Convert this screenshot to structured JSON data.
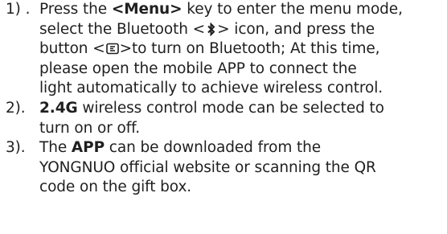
{
  "items": [
    {
      "number": "1) .",
      "line1": {
        "pre": "Press the ",
        "bold": "<Menu>",
        "post": " key to enter the menu mode,"
      },
      "line2": {
        "pre": "select the Bluetooth <",
        "post": "> icon, and press the"
      },
      "line3": {
        "pre": "button <",
        "post": ">to turn on Bluetooth; At this time,"
      },
      "line4": "please open the mobile APP to connect the",
      "line5": "light automatically to achieve wireless control."
    },
    {
      "number": "2).",
      "bold": "2.4G",
      "line1_post": " wireless control mode can be selected to",
      "line2": "turn on or off."
    },
    {
      "number": "3).",
      "line1_pre": "The ",
      "bold": "APP",
      "line1_post": " can be downloaded from the",
      "line2": "YONGNUO official website or scanning the QR",
      "line3": "code on the gift box."
    }
  ],
  "icons": {
    "bluetooth": "bluetooth-icon",
    "button": "power-button-icon"
  }
}
